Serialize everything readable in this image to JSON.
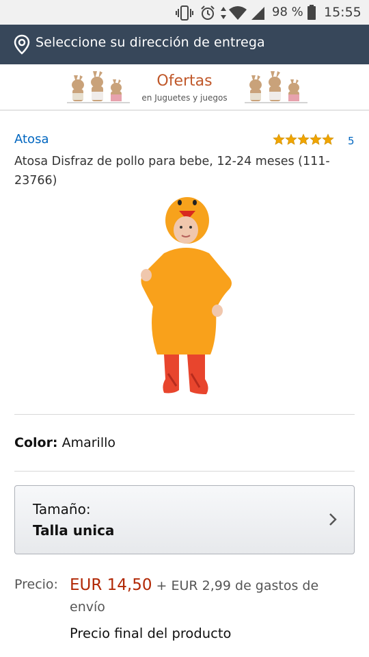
{
  "status_bar": {
    "battery_percent": "98 %",
    "time": "15:55",
    "icons": [
      "vibrate-icon",
      "alarm-icon",
      "wifi-icon",
      "signal-icon",
      "battery-icon"
    ]
  },
  "delivery": {
    "icon": "location-pin-icon",
    "label": "Seleccione su dirección de entrega"
  },
  "banner": {
    "title": "Ofertas",
    "subtitle": "en Juguetes y juegos",
    "title_color": "#c0582a"
  },
  "product": {
    "brand": "Atosa",
    "rating_stars": 5,
    "rating_count": "5",
    "title": "Atosa Disfraz de pollo para bebe, 12-24 meses (111-23766)",
    "color_label": "Color:",
    "color_value": "Amarillo",
    "size_label": "Tamaño:",
    "size_value": "Talla unica"
  },
  "price": {
    "label": "Precio:",
    "amount": "EUR 14,50",
    "shipping": " + EUR 2,99 de gastos de envío",
    "final_note": "Precio final del producto",
    "price_color": "#b12704"
  },
  "colors": {
    "delivery_bar": "#37475a",
    "link": "#0066c0",
    "star": "#f0a500"
  }
}
